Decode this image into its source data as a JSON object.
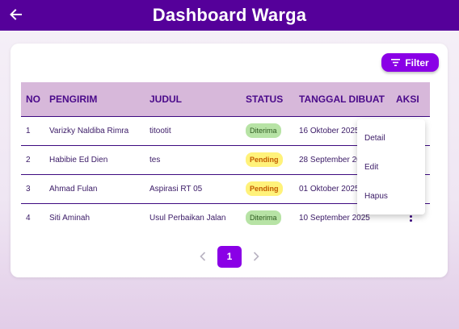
{
  "appbar": {
    "title": "Dashboard Warga",
    "back_icon": "arrow-left-icon"
  },
  "filter_button": {
    "label": "Filter",
    "icon": "filter-list-icon"
  },
  "table": {
    "columns": [
      "NO",
      "PENGIRIM",
      "JUDUL",
      "STATUS",
      "TANGGAL DIBUAT",
      "AKSI"
    ],
    "rows": [
      {
        "no": "1",
        "pengirim": "Varizky Naldiba Rimra",
        "judul": "titootit",
        "status": "Diterima",
        "tanggal": "16 Oktober 2025"
      },
      {
        "no": "2",
        "pengirim": "Habibie Ed Dien",
        "judul": "tes",
        "status": "Pending",
        "tanggal": "28 September 2025"
      },
      {
        "no": "3",
        "pengirim": "Ahmad Fulan",
        "judul": "Aspirasi RT 05",
        "status": "Pending",
        "tanggal": "01 Oktober 2025"
      },
      {
        "no": "4",
        "pengirim": "Siti Aminah",
        "judul": "Usul Perbaikan Jalan",
        "status": "Diterima",
        "tanggal": "10 September 2025"
      }
    ]
  },
  "action_menu": {
    "items": [
      "Detail",
      "Edit",
      "Hapus"
    ]
  },
  "pagination": {
    "current_page": "1"
  },
  "colors": {
    "appbar": "#55009a",
    "accent": "#8a00e6",
    "header_row": "#d7b8da",
    "badge_diterima": "#b7e3a5",
    "badge_pending": "#fff27a"
  }
}
